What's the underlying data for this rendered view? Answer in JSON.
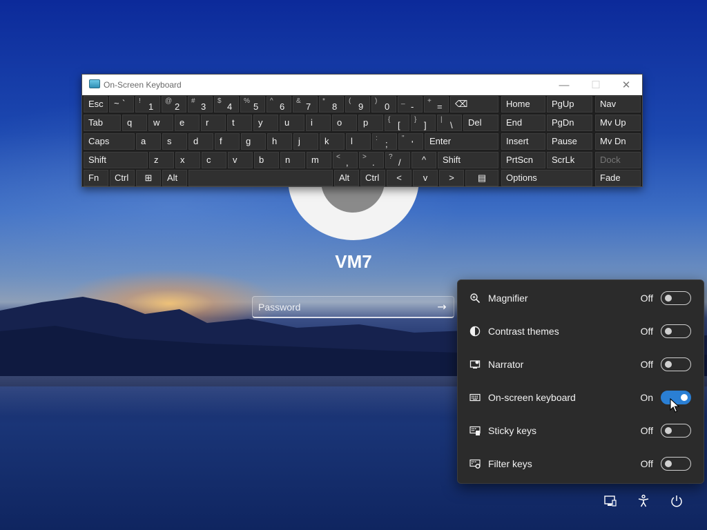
{
  "osk": {
    "title": "On-Screen Keyboard",
    "minimize": "—",
    "maximize": "☐",
    "close": "✕",
    "keys": {
      "esc": "Esc",
      "tilde_shift": "~",
      "tilde_main": "`",
      "n1s": "!",
      "n1": "1",
      "n2s": "@",
      "n2": "2",
      "n3s": "#",
      "n3": "3",
      "n4s": "$",
      "n4": "4",
      "n5s": "%",
      "n5": "5",
      "n6s": "^",
      "n6": "6",
      "n7s": "&",
      "n7": "7",
      "n8s": "*",
      "n8": "8",
      "n9s": "(",
      "n9": "9",
      "n0s": ")",
      "n0": "0",
      "minus_s": "_",
      "minus": "-",
      "equals_s": "+",
      "equals": "=",
      "backspace": "⌫",
      "home": "Home",
      "pgup": "PgUp",
      "nav": "Nav",
      "tab": "Tab",
      "q": "q",
      "w": "w",
      "e": "e",
      "r": "r",
      "t": "t",
      "y": "y",
      "u": "u",
      "i": "i",
      "o": "o",
      "p": "p",
      "lbr_s": "{",
      "lbr": "[",
      "rbr_s": "}",
      "rbr": "]",
      "pipe_s": "|",
      "bslash": "\\",
      "del": "Del",
      "end": "End",
      "pgdn": "PgDn",
      "mvup": "Mv Up",
      "caps": "Caps",
      "a": "a",
      "s": "s",
      "d": "d",
      "f": "f",
      "g": "g",
      "h": "h",
      "j": "j",
      "k": "k",
      "l": "l",
      "semi_s": ":",
      "semi": ";",
      "quote_s": "\"",
      "quote": "'",
      "enter": "Enter",
      "insert": "Insert",
      "pause": "Pause",
      "mvdn": "Mv Dn",
      "shift": "Shift",
      "z": "z",
      "x": "x",
      "c": "c",
      "v": "v",
      "b": "b",
      "n": "n",
      "m": "m",
      "comma_s": "<",
      "comma": ",",
      "period_s": ">",
      "period": ".",
      "slash_s": "?",
      "slash": "/",
      "up": "^",
      "shift_r": "Shift",
      "prtscn": "PrtScn",
      "scrlk": "ScrLk",
      "dock": "Dock",
      "fn": "Fn",
      "ctrl": "Ctrl",
      "win": "⊞",
      "alt": "Alt",
      "alt_r": "Alt",
      "ctrl_r": "Ctrl",
      "left": "<",
      "down": "v",
      "right": ">",
      "menu": "▤",
      "options": "Options",
      "fade": "Fade"
    }
  },
  "login": {
    "username": "VM7",
    "password_placeholder": "Password",
    "submit_icon": "→"
  },
  "accessibility": {
    "items": [
      {
        "label": "Magnifier",
        "state": "Off",
        "icon": "magnifier-icon",
        "on": false
      },
      {
        "label": "Contrast themes",
        "state": "Off",
        "icon": "contrast-icon",
        "on": false
      },
      {
        "label": "Narrator",
        "state": "Off",
        "icon": "narrator-icon",
        "on": false
      },
      {
        "label": "On-screen keyboard",
        "state": "On",
        "icon": "keyboard-icon",
        "on": true
      },
      {
        "label": "Sticky keys",
        "state": "Off",
        "icon": "sticky-keys-icon",
        "on": false
      },
      {
        "label": "Filter keys",
        "state": "Off",
        "icon": "filter-keys-icon",
        "on": false
      }
    ]
  },
  "colors": {
    "toggle_on": "#2a7fd4",
    "flyout_bg": "#2b2b2b",
    "key_bg": "#303030"
  }
}
